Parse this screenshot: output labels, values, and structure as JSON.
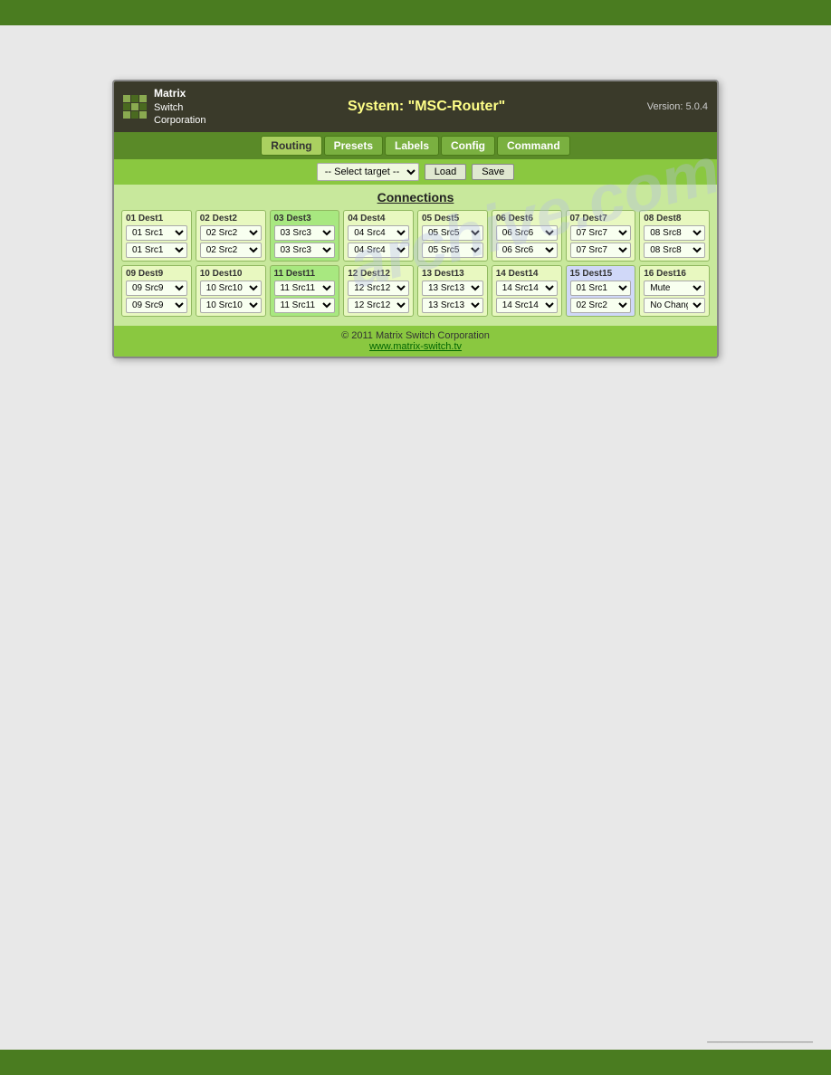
{
  "topBar": {
    "label": "top-bar"
  },
  "bottomBar": {
    "label": "bottom-bar"
  },
  "watermark": {
    "text": "archive.com"
  },
  "header": {
    "logoLines": [
      "Matrix",
      "Switch",
      "Corporation"
    ],
    "systemLabel": "System: ",
    "systemName": "\"MSC-Router\"",
    "versionLabel": "Version: 5.0.4"
  },
  "nav": {
    "tabs": [
      {
        "label": "Routing",
        "active": true
      },
      {
        "label": "Presets",
        "active": false
      },
      {
        "label": "Labels",
        "active": false
      },
      {
        "label": "Config",
        "active": false
      },
      {
        "label": "Command",
        "active": false
      }
    ]
  },
  "toolbar": {
    "selectPlaceholder": "-- Select target --",
    "loadButton": "Load",
    "saveButton": "Save"
  },
  "connections": {
    "title": "Connections",
    "row1": [
      {
        "dest": "01 Dest1",
        "src1": "01 Src1",
        "src2": "01 Src1",
        "bg": "normal"
      },
      {
        "dest": "02 Dest2",
        "src1": "02 Src2",
        "src2": "02 Src2",
        "bg": "normal"
      },
      {
        "dest": "03 Dest3",
        "src1": "03 Src3",
        "src2": "03 Src3",
        "bg": "green"
      },
      {
        "dest": "04 Dest4",
        "src1": "04 Src4",
        "src2": "04 Src4",
        "bg": "normal"
      },
      {
        "dest": "05 Dest5",
        "src1": "05 Src5",
        "src2": "05 Src5",
        "bg": "normal"
      },
      {
        "dest": "06 Dest6",
        "src1": "06 Src6",
        "src2": "06 Src6",
        "bg": "normal"
      },
      {
        "dest": "07 Dest7",
        "src1": "07 Src7",
        "src2": "07 Src7",
        "bg": "normal"
      },
      {
        "dest": "08 Dest8",
        "src1": "08 Src8",
        "src2": "08 Src8",
        "bg": "normal"
      }
    ],
    "row2": [
      {
        "dest": "09 Dest9",
        "src1": "09 Src9",
        "src2": "09 Src9",
        "bg": "normal"
      },
      {
        "dest": "10 Dest10",
        "src1": "10 Src10",
        "src2": "10 Src10",
        "bg": "normal"
      },
      {
        "dest": "11 Dest11",
        "src1": "11 Src11",
        "src2": "11 Src11",
        "bg": "green"
      },
      {
        "dest": "12 Dest12",
        "src1": "12 Src12",
        "src2": "12 Src12",
        "bg": "normal"
      },
      {
        "dest": "13 Dest13",
        "src1": "13 Src13",
        "src2": "13 Src13",
        "bg": "normal"
      },
      {
        "dest": "14 Dest14",
        "src1": "14 Src14",
        "src2": "14 Src14",
        "bg": "normal"
      },
      {
        "dest": "15 Dest15",
        "src1": "01 Src1",
        "src2": "02 Src2",
        "bg": "blue"
      },
      {
        "dest": "16 Dest16",
        "src1": "Mute",
        "src2": "No Change",
        "bg": "normal"
      }
    ]
  },
  "footer": {
    "copyright": "© 2011 Matrix Switch Corporation",
    "website": "www.matrix-switch.tv"
  },
  "bottomPageText": "_____________________"
}
